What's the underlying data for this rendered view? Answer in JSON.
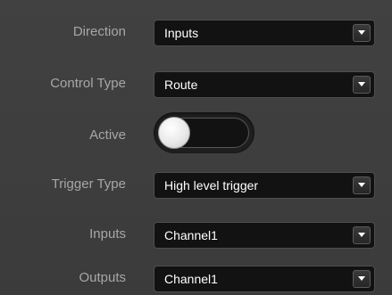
{
  "form": {
    "direction": {
      "label": "Direction",
      "value": "Inputs",
      "icon": "chevron-down-icon"
    },
    "control_type": {
      "label": "Control Type",
      "value": "Route",
      "icon": "chevron-down-icon"
    },
    "active": {
      "label": "Active",
      "state": "off"
    },
    "trigger_type": {
      "label": "Trigger Type",
      "value": "High level trigger",
      "icon": "chevron-down-icon"
    },
    "inputs": {
      "label": "Inputs",
      "value": "Channel1",
      "icon": "chevron-down-icon"
    },
    "outputs": {
      "label": "Outputs",
      "value": "Channel1",
      "icon": "chevron-down-icon"
    }
  },
  "colors": {
    "background": "#3d3d3d",
    "label_text": "#a7a7a7",
    "field_background": "#121212",
    "field_text": "#ffffff",
    "toggle_knob": "#e9e9e9"
  }
}
